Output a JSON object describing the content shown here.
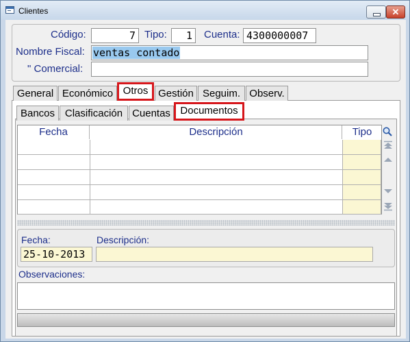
{
  "window": {
    "title": "Clientes"
  },
  "header": {
    "codigo_label": "Código:",
    "codigo_value": "7",
    "tipo_label": "Tipo:",
    "tipo_value": "1",
    "cuenta_label": "Cuenta:",
    "cuenta_value": "4300000007",
    "nombre_fiscal_label": "Nombre Fiscal:",
    "nombre_fiscal_value": "ventas contado",
    "comercial_label": "\"  Comercial:",
    "comercial_value": ""
  },
  "main_tabs": [
    {
      "label": "General"
    },
    {
      "label": "Económico"
    },
    {
      "label": "Otros",
      "active": true
    },
    {
      "label": "Gestión"
    },
    {
      "label": "Seguim."
    },
    {
      "label": "Observ."
    }
  ],
  "sub_tabs": [
    {
      "label": "Bancos"
    },
    {
      "label": "Clasificación"
    },
    {
      "label": "Cuentas"
    },
    {
      "label": "Documentos",
      "active": true
    }
  ],
  "grid": {
    "columns": [
      "Fecha",
      "Descripción",
      "Tipo"
    ],
    "rows": [
      [
        "",
        "",
        ""
      ],
      [
        "",
        "",
        ""
      ],
      [
        "",
        "",
        ""
      ],
      [
        "",
        "",
        ""
      ],
      [
        "",
        "",
        ""
      ]
    ]
  },
  "detail": {
    "fecha_label": "Fecha:",
    "fecha_value": "25-10-2013",
    "descripcion_label": "Descripción:",
    "descripcion_value": "",
    "observaciones_label": "Observaciones:",
    "observaciones_value": ""
  },
  "colors": {
    "label": "#1c2e8a",
    "highlight": "#d6161b",
    "readonly_field": "#fbf7d3",
    "selection": "#99c9ef"
  },
  "icons": [
    "window-icon",
    "minimize-icon",
    "close-icon",
    "search-icon",
    "scroll-top-icon",
    "scroll-up-icon",
    "scroll-down-icon",
    "scroll-bottom-icon"
  ]
}
